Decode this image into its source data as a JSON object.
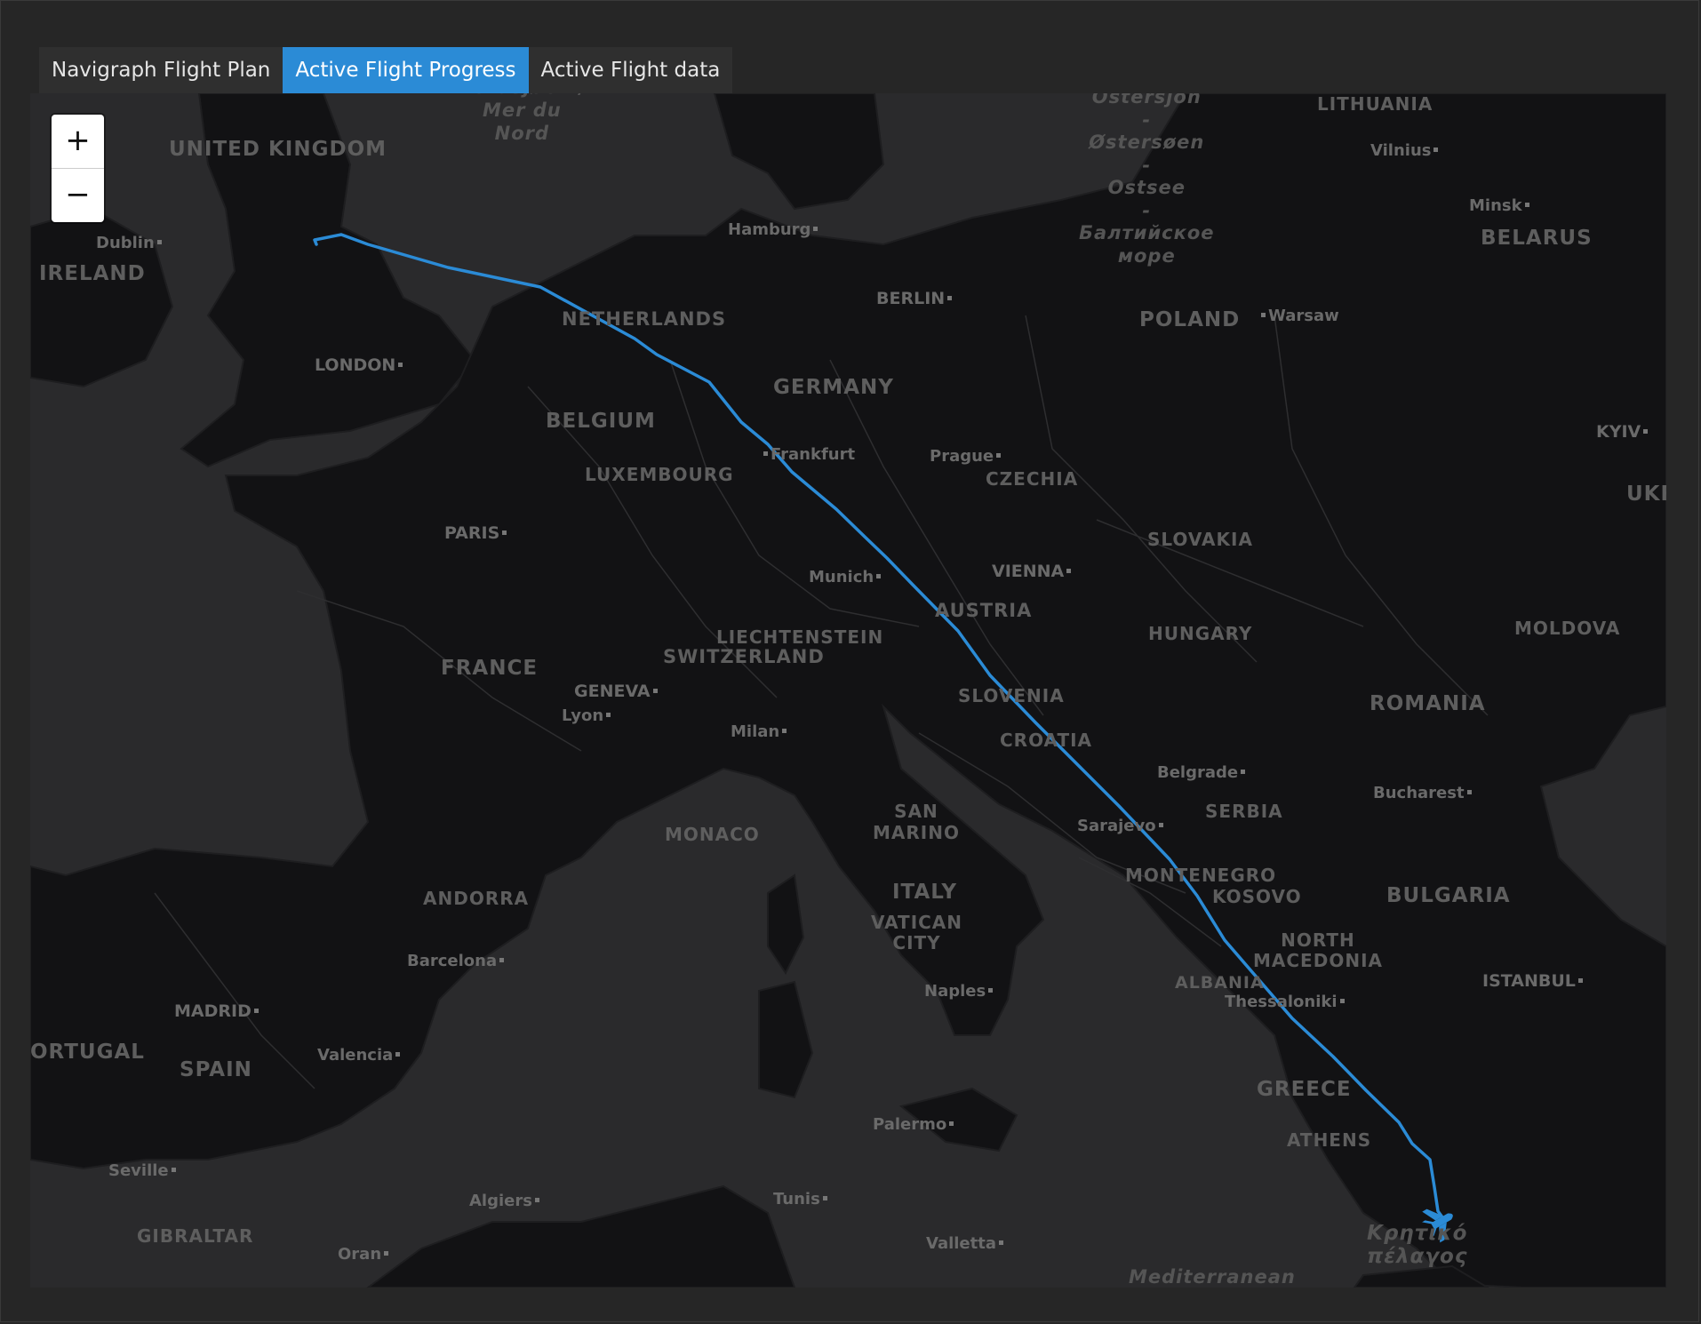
{
  "tabs": [
    {
      "label": "Navigraph Flight Plan",
      "active": false
    },
    {
      "label": "Active Flight Progress",
      "active": true
    },
    {
      "label": "Active Flight data",
      "active": false
    }
  ],
  "zoom": {
    "in_label": "+",
    "out_label": "−"
  },
  "colors": {
    "route": "#2b8bd6",
    "active_tab": "#2b8bd6",
    "map_bg": "#2a2a2c",
    "land": "#111113"
  },
  "labels": {
    "uk": "UNITED KINGDOM",
    "ireland": "IRELAND",
    "dublin": "Dublin",
    "london": "LONDON",
    "north_sea": "Nordsjøen /\nMer du\nNord",
    "baltic": "Ostersjön\n-\nØstersøen\n-\nOstsee\n-\nБалтийское\nморе",
    "lithuania": "LITHUANIA",
    "vilnius": "Vilnius",
    "minsk": "Minsk",
    "belarus": "BELARUS",
    "hamburg": "Hamburg",
    "berlin": "BERLIN",
    "poland": "POLAND",
    "warsaw": "Warsaw",
    "netherlands": "NETHERLANDS",
    "germany": "GERMANY",
    "belgium": "BELGIUM",
    "luxembourg": "LUXEMBOURG",
    "frankfurt": "Frankfurt",
    "prague": "Prague",
    "czechia": "CZECHIA",
    "kyiv": "KYIV",
    "ukr": "UKR",
    "paris": "PARIS",
    "slovakia": "SLOVAKIA",
    "munich": "Munich",
    "vienna": "VIENNA",
    "austria": "AUSTRIA",
    "hungary": "HUNGARY",
    "liechtenstein": "LIECHTENSTEIN",
    "switzerland": "SWITZERLAND",
    "moldova": "MOLDOVA",
    "france": "FRANCE",
    "geneva": "GENEVA",
    "lyon": "Lyon",
    "slovenia": "SLOVENIA",
    "romania": "ROMANIA",
    "milan": "Milan",
    "croatia": "CROATIA",
    "belgrade": "Belgrade",
    "bucharest": "Bucharest",
    "monaco": "MONACO",
    "san_marino": "SAN\nMARINO",
    "sarajevo": "Sarajevo",
    "serbia": "SERBIA",
    "montenegro": "MONTENEGRO",
    "kosovo": "KOSOVO",
    "bulgaria": "BULGARIA",
    "andorra": "ANDORRA",
    "italy": "ITALY",
    "vatican": "VATICAN\nCITY",
    "north_macedonia": "NORTH\nMACEDONIA",
    "barcelona": "Barcelona",
    "albania": "ALBANIA",
    "istanbul": "ISTANBUL",
    "naples": "Naples",
    "thessaloniki": "Thessaloniki",
    "madrid": "MADRID",
    "portugal": "ORTUGAL",
    "spain": "SPAIN",
    "valencia": "Valencia",
    "greece": "GREECE",
    "palermo": "Palermo",
    "athens": "ATHENS",
    "seville": "Seville",
    "algiers": "Algiers",
    "tunis": "Tunis",
    "cretan_sea": "Κρητικό\nπέλαγος",
    "gibraltar": "GIBRALTAR",
    "oran": "Oran",
    "valletta": "Valletta",
    "mediterranean": "Mediterranean"
  }
}
